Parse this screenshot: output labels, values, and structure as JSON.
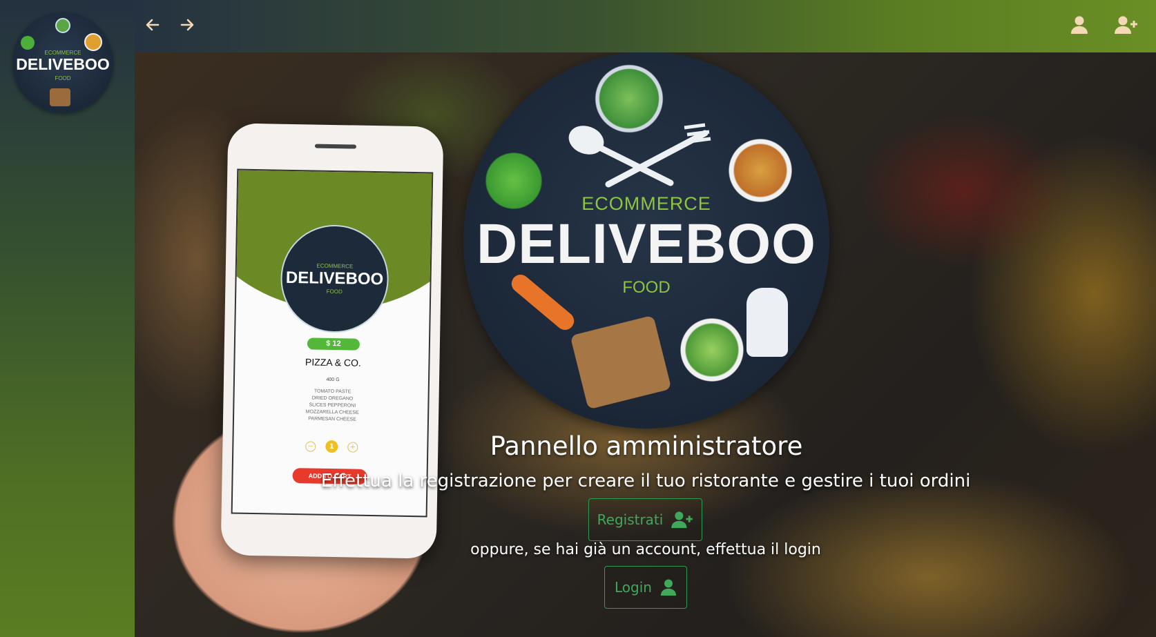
{
  "logo": {
    "top_text": "ECOMMERCE",
    "brand": "DELIVEBOO",
    "bottom_text": "FOOD"
  },
  "topbar": {
    "back_icon": "arrow-left-icon",
    "forward_icon": "arrow-right-icon",
    "user_icon": "user-icon",
    "add_user_icon": "user-plus-icon"
  },
  "phone": {
    "price": "$ 12",
    "dish": "PIZZA & CO.",
    "weight": "400 G",
    "ingredients": [
      "TOMATO PASTE",
      "DRIED OREGANO",
      "SLICES PEPPERONI",
      "MOZZARELLA CHEESE",
      "PARMESAN CHEESE"
    ],
    "qty_minus": "−",
    "qty_value": "1",
    "qty_plus": "+",
    "add_to_cart": "ADD TO CART"
  },
  "main": {
    "title": "Pannello amministratore",
    "subtitle": "Effettua la registrazione per creare il tuo ristorante e gestire i tuoi ordini",
    "register_label": "Registrati",
    "or_text": "oppure, se hai già un account, effettua il login",
    "login_label": "Login"
  },
  "colors": {
    "accent_green": "#3fa85b",
    "brand_green": "#8cc63f",
    "topbar_end": "#6a8f25"
  }
}
